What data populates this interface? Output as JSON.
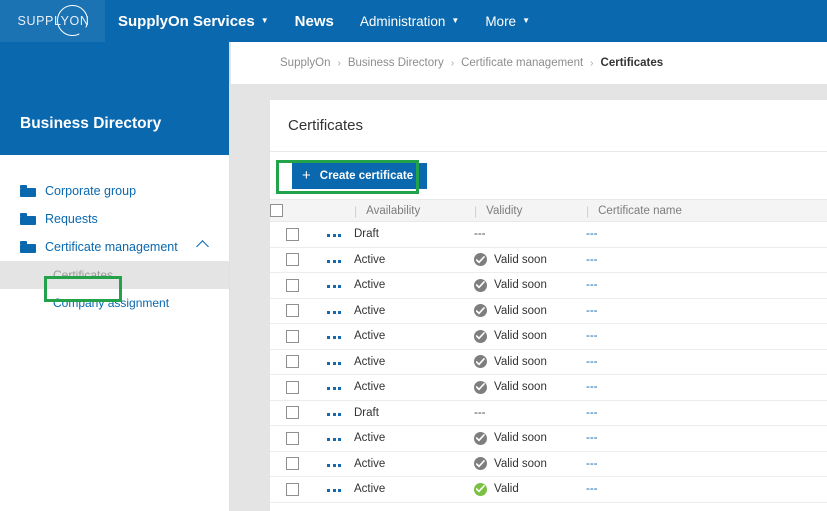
{
  "navbar": {
    "logo_text": "SUPPLYON",
    "logo_icon": "supplyon-circle-logo",
    "items": [
      {
        "label": "SupplyOn Services",
        "caret": "▼",
        "style": "bold"
      },
      {
        "label": "News",
        "caret": "",
        "style": "bold"
      },
      {
        "label": "Administration",
        "caret": "▼",
        "style": "reg"
      },
      {
        "label": "More",
        "caret": "▼",
        "style": "reg"
      }
    ]
  },
  "sidebar": {
    "title": "Business Directory",
    "items": [
      {
        "label": "Corporate group",
        "icon": "folder-icon",
        "expanded": false
      },
      {
        "label": "Requests",
        "icon": "folder-icon",
        "expanded": false
      },
      {
        "label": "Certificate management",
        "icon": "folder-icon",
        "expanded": true,
        "chevron": "chevron-up-icon"
      }
    ],
    "subitems": [
      {
        "label": "Certificates",
        "selected": true,
        "annotated": true
      },
      {
        "label": "Company assignment",
        "selected": false,
        "annotated": false
      }
    ]
  },
  "breadcrumb": {
    "separator": "›",
    "items": [
      "SupplyOn",
      "Business Directory",
      "Certificate management",
      "Certificates"
    ]
  },
  "card": {
    "title": "Certificates",
    "create_button": {
      "label": "Create certificate",
      "icon": "plus-icon",
      "annotated": true
    }
  },
  "table": {
    "columns": [
      "",
      "",
      "Availability",
      "Validity",
      "Certificate name"
    ],
    "header_select_all": "select-all-checkbox",
    "row_menu_icon": "more-options-icon",
    "rows": [
      {
        "availability": "Draft",
        "validity": "---",
        "validity_icon": "none",
        "name": "---"
      },
      {
        "availability": "Active",
        "validity": "Valid soon",
        "validity_icon": "check-gray",
        "name": "---"
      },
      {
        "availability": "Active",
        "validity": "Valid soon",
        "validity_icon": "check-gray",
        "name": "---"
      },
      {
        "availability": "Active",
        "validity": "Valid soon",
        "validity_icon": "check-gray",
        "name": "---"
      },
      {
        "availability": "Active",
        "validity": "Valid soon",
        "validity_icon": "check-gray",
        "name": "---"
      },
      {
        "availability": "Active",
        "validity": "Valid soon",
        "validity_icon": "check-gray",
        "name": "---"
      },
      {
        "availability": "Active",
        "validity": "Valid soon",
        "validity_icon": "check-gray",
        "name": "---"
      },
      {
        "availability": "Draft",
        "validity": "---",
        "validity_icon": "none",
        "name": "---"
      },
      {
        "availability": "Active",
        "validity": "Valid soon",
        "validity_icon": "check-gray",
        "name": "---"
      },
      {
        "availability": "Active",
        "validity": "Valid soon",
        "validity_icon": "check-gray",
        "name": "---"
      },
      {
        "availability": "Active",
        "validity": "Valid",
        "validity_icon": "check-green",
        "name": "---"
      }
    ]
  },
  "colors": {
    "brand_blue": "#0a68ae",
    "logo_panel_blue": "#1c73b4",
    "annotation_green": "#22a34a",
    "status_green": "#7ac143",
    "status_gray": "#7e7e7e",
    "page_gray": "#e4e4e4"
  }
}
